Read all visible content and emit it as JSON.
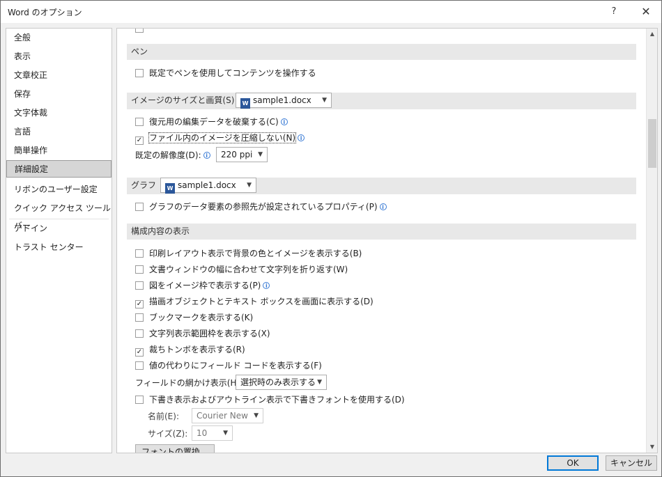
{
  "window": {
    "title": "Word のオプション",
    "help_label": "?",
    "close_label": "✕"
  },
  "nav": {
    "items": [
      {
        "label": "全般"
      },
      {
        "label": "表示"
      },
      {
        "label": "文章校正"
      },
      {
        "label": "保存"
      },
      {
        "label": "文字体裁"
      },
      {
        "label": "言語"
      },
      {
        "label": "簡単操作"
      },
      {
        "label": "詳細設定",
        "selected": true
      },
      {
        "label": "リボンのユーザー設定"
      },
      {
        "label": "クイック アクセス ツール バー"
      },
      {
        "label": "アドイン"
      },
      {
        "label": "トラスト センター"
      }
    ]
  },
  "content": {
    "pen_section": {
      "header": "ペン",
      "option1": "既定でペンを使用してコンテンツを操作する"
    },
    "image_section": {
      "header": "イメージのサイズと画質(S)",
      "doc": "sample1.docx",
      "option1": "復元用の編集データを破棄する(C)",
      "option2": "ファイル内のイメージを圧縮しない(N)",
      "resolution_label": "既定の解像度(D):",
      "resolution_value": "220 ppi"
    },
    "chart_section": {
      "header": "グラフ",
      "doc": "sample1.docx",
      "option1": "グラフのデータ要素の参照先が設定されているプロパティ(P)"
    },
    "display_section": {
      "header": "構成内容の表示",
      "options": [
        {
          "label": "印刷レイアウト表示で背景の色とイメージを表示する(B)",
          "checked": false,
          "info": false
        },
        {
          "label": "文書ウィンドウの幅に合わせて文字列を折り返す(W)",
          "checked": false,
          "info": false
        },
        {
          "label": "図をイメージ枠で表示する(P)",
          "checked": false,
          "info": true
        },
        {
          "label": "描画オブジェクトとテキスト ボックスを画面に表示する(D)",
          "checked": true,
          "info": false
        },
        {
          "label": "ブックマークを表示する(K)",
          "checked": false,
          "info": false
        },
        {
          "label": "文字列表示範囲枠を表示する(X)",
          "checked": false,
          "info": false
        },
        {
          "label": "裁ちトンボを表示する(R)",
          "checked": true,
          "info": false
        },
        {
          "label": "値の代わりにフィールド コードを表示する(F)",
          "checked": false,
          "info": false
        }
      ],
      "field_shading_label": "フィールドの網かけ表示(H):",
      "field_shading_value": "選択時のみ表示する",
      "draft_font_option": "下書き表示およびアウトライン表示で下書きフォントを使用する(D)",
      "name_label": "名前(E):",
      "name_value": "Courier New",
      "size_label": "サイズ(Z):",
      "size_value": "10",
      "font_sub_button": "フォントの置換(F)..."
    }
  },
  "footer": {
    "ok_label": "OK",
    "cancel_label": "キャンセル"
  }
}
